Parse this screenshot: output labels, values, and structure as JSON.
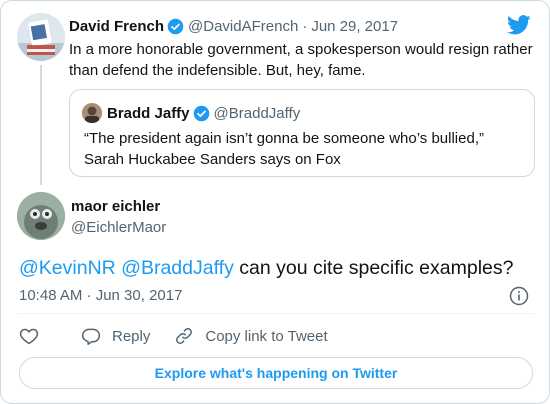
{
  "parent": {
    "name": "David French",
    "handle": "@DavidAFrench",
    "separator": "·",
    "date": "Jun 29, 2017",
    "text": "In a more honorable government, a spokesperson would resign rather than defend the indefensible. But, hey, fame."
  },
  "quote": {
    "name": "Bradd Jaffy",
    "handle": "@BraddJaffy",
    "text": "“The president again isn’t gonna be someone who’s bullied,” Sarah Huckabee Sanders says on Fox"
  },
  "reply": {
    "name": "maor eichler",
    "handle": "@EichlerMaor",
    "mention1": "@KevinNR",
    "mention2": "@BraddJaffy",
    "body": " can you cite specific examples?",
    "time": "10:48 AM · Jun 30, 2017"
  },
  "actions": {
    "reply_label": "Reply",
    "copy_label": "Copy link to Tweet"
  },
  "explore_label": "Explore what's happening on Twitter",
  "icons": {
    "logo": "twitter-bird-icon",
    "verified": "verified-badge-icon",
    "info": "info-icon",
    "like": "heart-icon",
    "reply": "reply-bubble-icon",
    "copy": "link-icon"
  },
  "colors": {
    "accent": "#1d9bf0",
    "text": "#0f1419",
    "muted": "#536471",
    "border": "#cfd9de"
  }
}
